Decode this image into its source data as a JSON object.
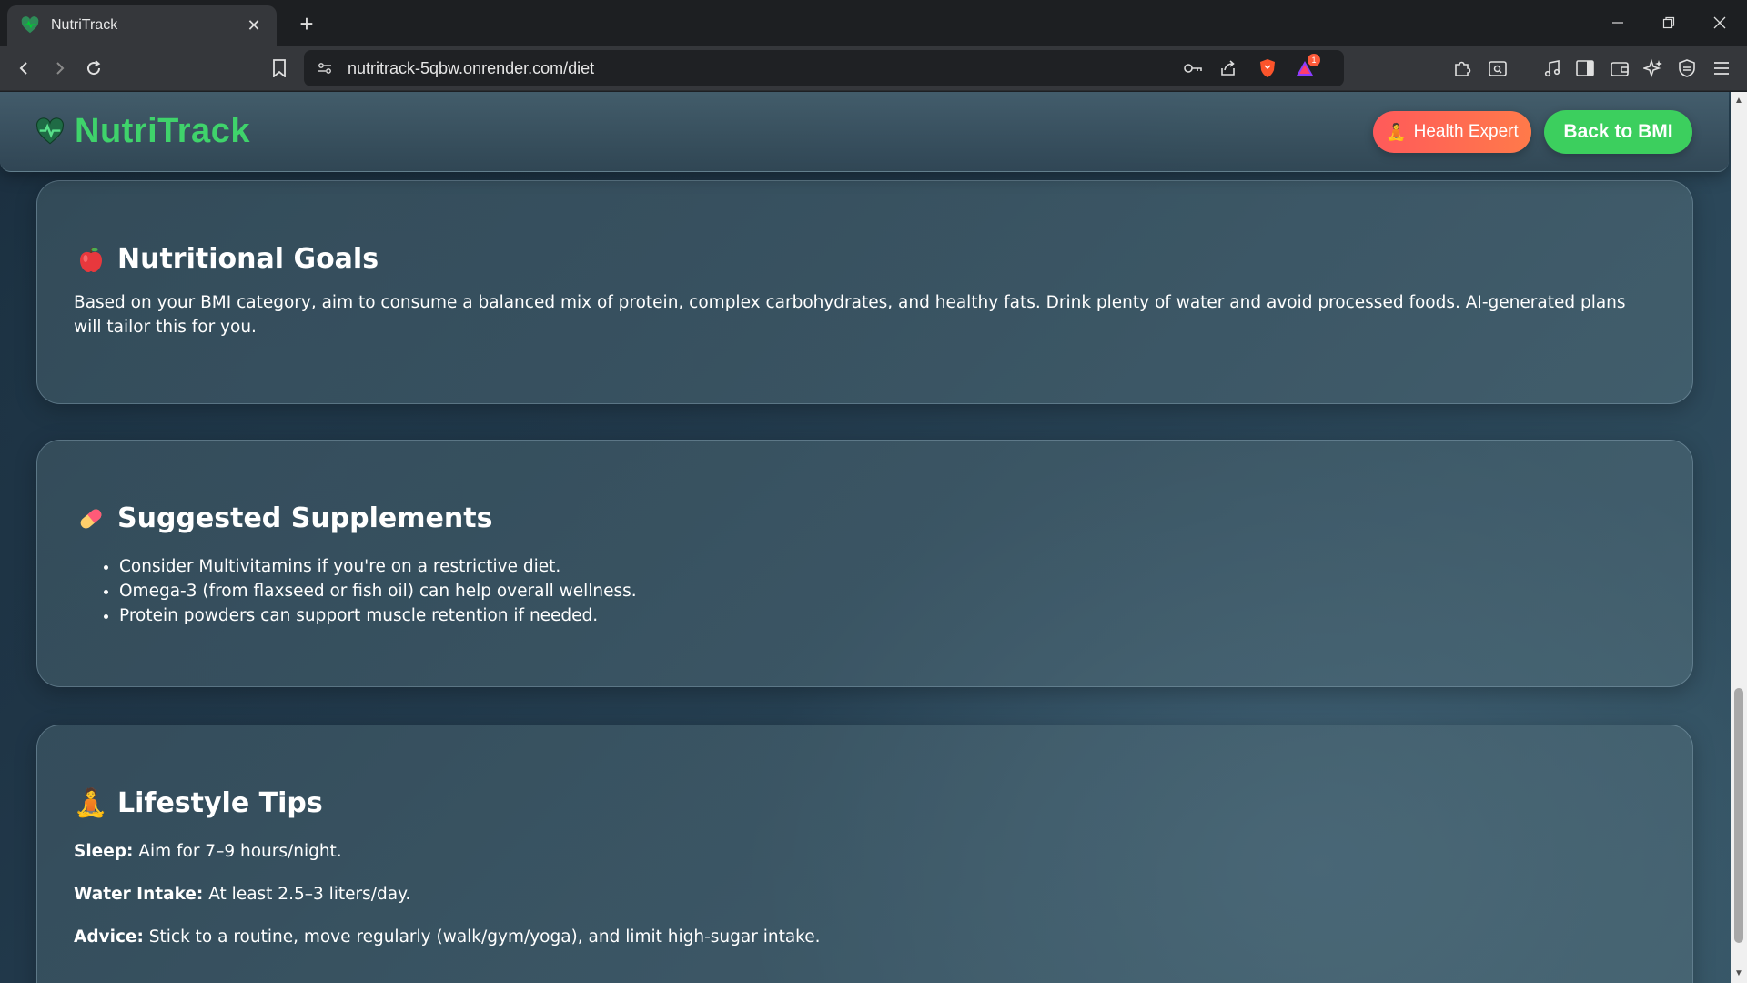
{
  "browser": {
    "tab_title": "NutriTrack",
    "url": "nutritrack-5qbw.onrender.com/diet",
    "notification_count": "1"
  },
  "header": {
    "brand": "NutriTrack",
    "expert_button": "Health Expert",
    "back_button": "Back to BMI"
  },
  "sections": {
    "goals": {
      "title": "Nutritional Goals",
      "text": "Based on your BMI category, aim to consume a balanced mix of protein, complex carbohydrates, and healthy fats. Drink plenty of water and avoid processed foods. AI-generated plans will tailor this for you."
    },
    "supplements": {
      "title": "Suggested Supplements",
      "items": [
        "Consider Multivitamins if you're on a restrictive diet.",
        "Omega-3 (from flaxseed or fish oil) can help overall wellness.",
        "Protein powders can support muscle retention if needed."
      ]
    },
    "lifestyle": {
      "title": "Lifestyle Tips",
      "tips": [
        {
          "label": "Sleep:",
          "text": " Aim for 7–9 hours/night."
        },
        {
          "label": "Water Intake:",
          "text": " At least 2.5–3 liters/day."
        },
        {
          "label": "Advice:",
          "text": " Stick to a routine, move regularly (walk/gym/yoga), and limit high-sugar intake."
        }
      ]
    }
  },
  "colors": {
    "brand_green": "#3fd36b",
    "back_button": "#3ccf5e",
    "expert_button": "#ff5a5a"
  }
}
